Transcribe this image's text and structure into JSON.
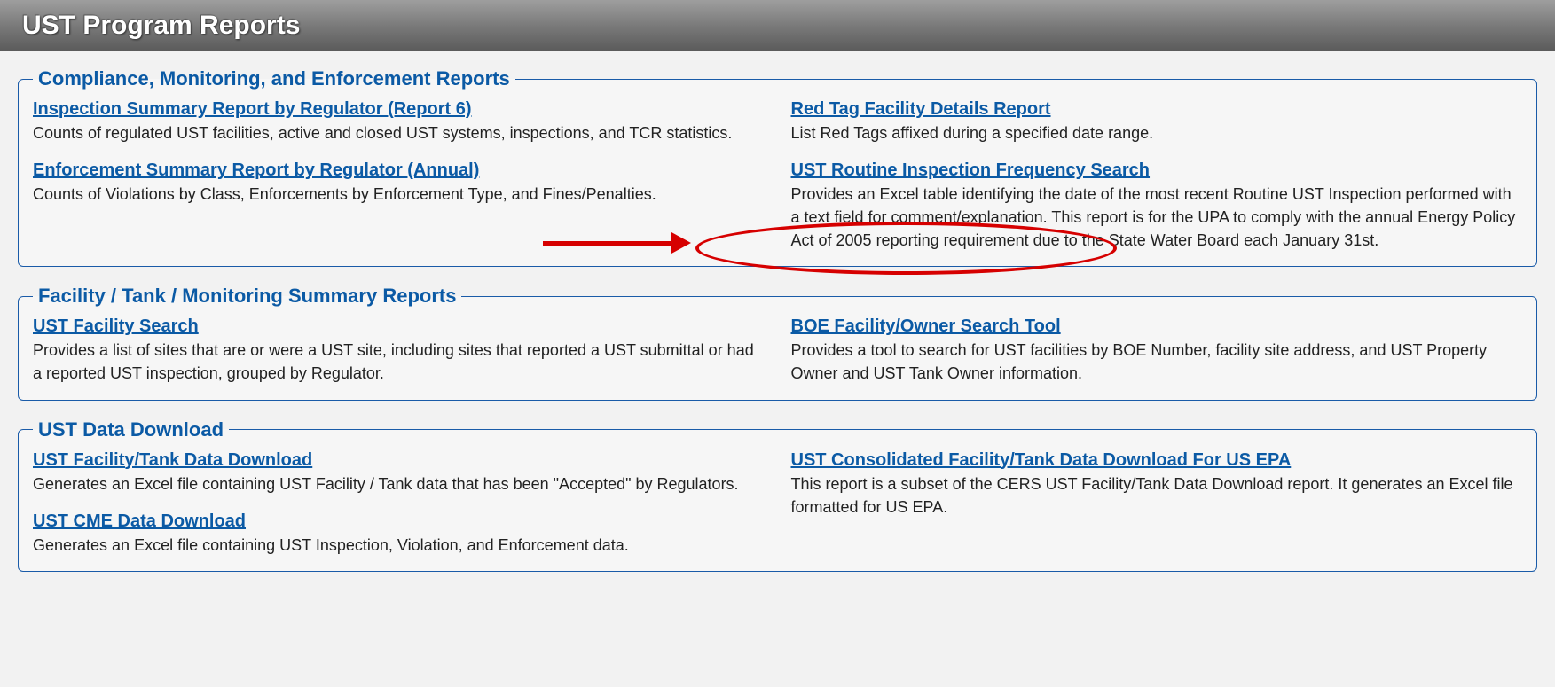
{
  "header": {
    "title": "UST Program Reports"
  },
  "sections": {
    "cme": {
      "legend": "Compliance, Monitoring, and Enforcement Reports",
      "left": [
        {
          "link": "Inspection Summary Report by Regulator (Report 6)",
          "desc": "Counts of regulated UST facilities, active and closed UST systems, inspections, and TCR statistics."
        },
        {
          "link": "Enforcement Summary Report by Regulator (Annual)",
          "desc": "Counts of Violations by Class, Enforcements by Enforcement Type, and Fines/Penalties."
        }
      ],
      "right": [
        {
          "link": "Red Tag Facility Details Report",
          "desc": "List Red Tags affixed during a specified date range."
        },
        {
          "link": "UST Routine Inspection Frequency Search",
          "desc": "Provides an Excel table identifying the date of the most recent Routine UST Inspection performed with a text field for comment/explanation. This report is for the UPA to comply with the annual Energy Policy Act of 2005 reporting requirement due to the State Water Board each January 31st."
        }
      ]
    },
    "facility": {
      "legend": "Facility / Tank / Monitoring Summary Reports",
      "left": [
        {
          "link": "UST Facility Search",
          "desc": "Provides a list of sites that are or were a UST site, including sites that reported a UST submittal or had a reported UST inspection, grouped by Regulator."
        }
      ],
      "right": [
        {
          "link": "BOE Facility/Owner Search Tool",
          "desc": "Provides a tool to search for UST facilities by BOE Number, facility site address, and UST Property Owner and UST Tank Owner information."
        }
      ]
    },
    "download": {
      "legend": "UST Data Download",
      "left": [
        {
          "link": "UST Facility/Tank Data Download",
          "desc": "Generates an Excel file containing UST Facility / Tank data that has been \"Accepted\" by Regulators."
        },
        {
          "link": "UST CME Data Download",
          "desc": "Generates an Excel file containing UST Inspection, Violation, and Enforcement data."
        }
      ],
      "right": [
        {
          "link": "UST Consolidated Facility/Tank Data Download For US EPA",
          "desc": "This report is a subset of the CERS UST Facility/Tank Data Download report. It generates an Excel file formatted for US EPA."
        }
      ]
    }
  }
}
